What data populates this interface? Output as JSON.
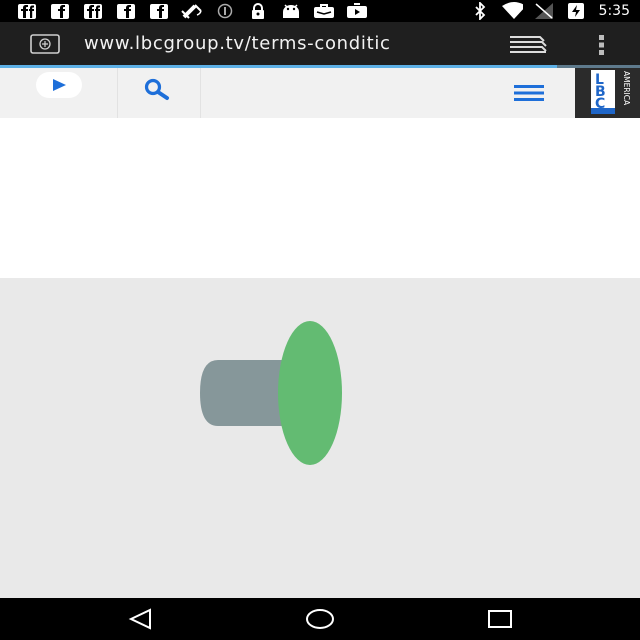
{
  "status_bar": {
    "time": "5:35",
    "notification_icons": [
      "facebook-icon",
      "facebook-icon",
      "facebook-icon",
      "facebook-icon",
      "facebook-icon",
      "satellite-icon",
      "circle-info-icon",
      "lock-icon",
      "android-icon",
      "briefcase-icon",
      "youtube-icon"
    ],
    "system_icons": [
      "bluetooth-icon",
      "wifi-icon",
      "signal-icon",
      "battery-charging-icon"
    ]
  },
  "browser": {
    "url": "www.lbcgroup.tv/terms-conditic",
    "load_progress": 0.87
  },
  "site_header": {
    "logo_letters": [
      "L",
      "B",
      "C"
    ],
    "logo_subtext": "AMERICA",
    "accent_color": "#1e6fd9"
  },
  "content": {
    "player_colors": {
      "body": "#86979a",
      "cone": "#63bb72",
      "background": "#e9e9e9"
    }
  }
}
